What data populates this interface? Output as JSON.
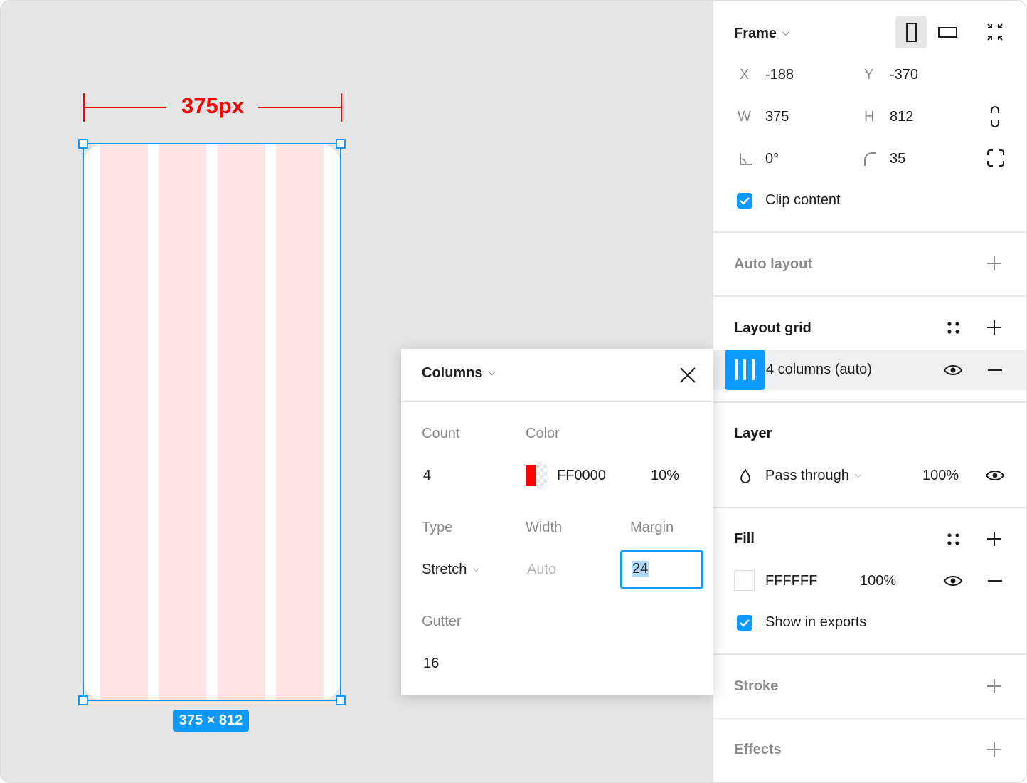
{
  "canvas": {
    "measure_label": "375px",
    "size_badge": "375 × 812",
    "grid_color": "#FFE5E5",
    "selection_color": "#0D99FF"
  },
  "popover": {
    "title": "Columns",
    "count_label": "Count",
    "count_value": "4",
    "color_label": "Color",
    "color_hex": "FF0000",
    "color_opacity": "10%",
    "type_label": "Type",
    "type_value": "Stretch",
    "width_label": "Width",
    "width_value": "Auto",
    "margin_label": "Margin",
    "margin_value": "24",
    "gutter_label": "Gutter",
    "gutter_value": "16"
  },
  "frame": {
    "title": "Frame",
    "x_label": "X",
    "x_value": "-188",
    "y_label": "Y",
    "y_value": "-370",
    "w_label": "W",
    "w_value": "375",
    "h_label": "H",
    "h_value": "812",
    "rotation_value": "0°",
    "radius_value": "35",
    "clip_content_label": "Clip content",
    "clip_content_checked": true
  },
  "auto_layout": {
    "title": "Auto layout"
  },
  "layout_grid": {
    "title": "Layout grid",
    "item_label": "4 columns (auto)"
  },
  "layer": {
    "title": "Layer",
    "blend_mode": "Pass through",
    "opacity": "100%"
  },
  "fill": {
    "title": "Fill",
    "hex": "FFFFFF",
    "opacity": "100%",
    "show_in_exports_label": "Show in exports",
    "show_in_exports_checked": true
  },
  "stroke": {
    "title": "Stroke"
  },
  "effects": {
    "title": "Effects"
  },
  "icons": {
    "frame_chevron": "chevron-down-icon",
    "portrait": "portrait-icon",
    "landscape": "landscape-icon",
    "collapse": "collapse-icon",
    "constrain": "constrain-proportions-icon",
    "corner_radius": "corner-radius-icon",
    "independent_corners": "independent-corners-icon",
    "add": "plus-icon",
    "remove": "minus-icon",
    "visibility": "eye-icon",
    "styles": "styles-grid-icon",
    "blend": "blend-mode-icon",
    "close": "close-icon"
  }
}
